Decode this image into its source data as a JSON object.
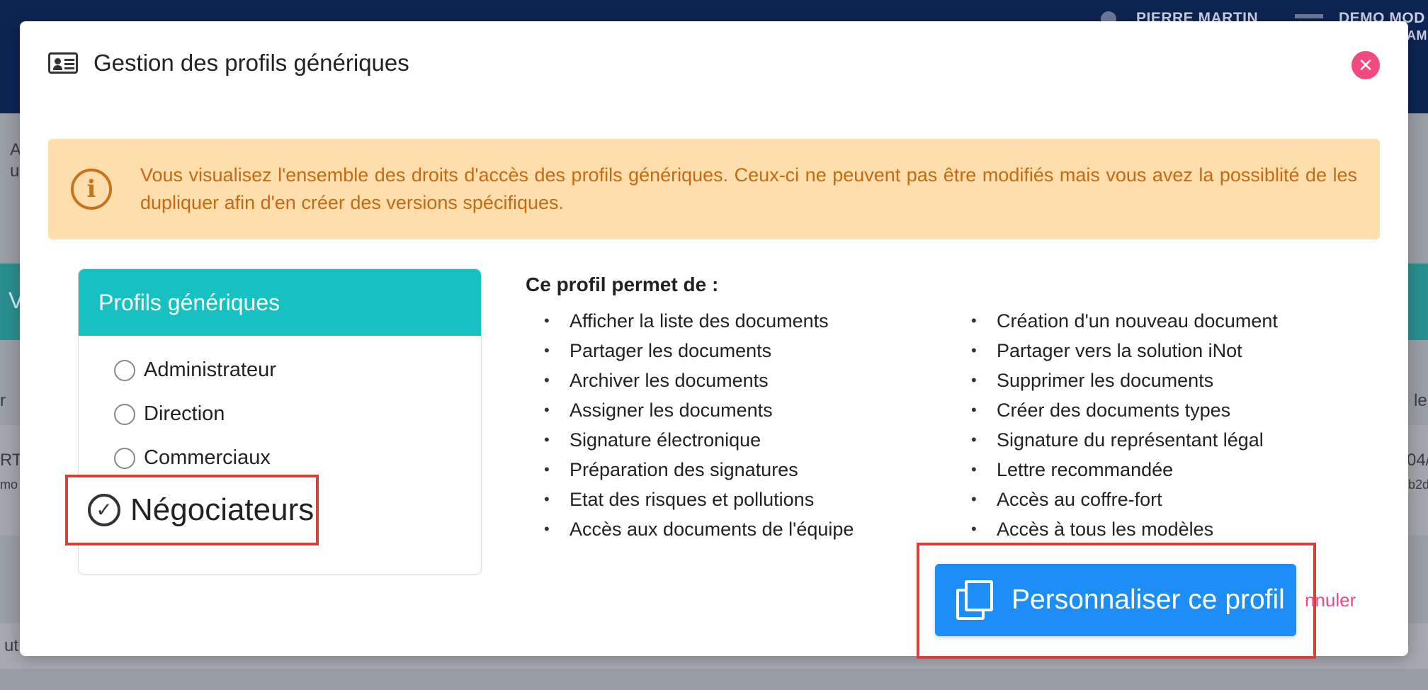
{
  "background": {
    "user_name": "PIERRE MARTIN",
    "demo_label": "DEMO MOD",
    "demo_sub": "AM",
    "fragments": {
      "a": "A",
      "u": "u",
      "v": "V",
      "r": "r",
      "rt": "RT",
      "mo": "mo",
      "ut": "ut",
      "le": "e le",
      "num": "04/",
      "code": "b2d"
    }
  },
  "modal": {
    "title": "Gestion des profils génériques",
    "close_icon": "close-icon",
    "alert_text": "Vous visualisez l'ensemble des droits d'accès des profils génériques. Ceux-ci ne peuvent pas être modifiés mais vous avez la possiblité de les dupliquer afin d'en créer des versions spécifiques.",
    "profiles": {
      "title": "Profils génériques",
      "items": [
        {
          "label": "Administrateur"
        },
        {
          "label": "Direction"
        },
        {
          "label": "Commerciaux"
        }
      ],
      "selected": {
        "label": "Négociateurs"
      }
    },
    "permissions": {
      "title": "Ce profil permet de :",
      "left": [
        "Afficher la liste des documents",
        "Partager les documents",
        "Archiver les documents",
        "Assigner les documents",
        "Signature électronique",
        "Préparation des signatures",
        "Etat des risques et pollutions",
        "Accès aux documents de l'équipe"
      ],
      "right": [
        "Création d'un nouveau document",
        "Partager vers la solution iNot",
        "Supprimer les documents",
        "Créer des documents types",
        "Signature du représentant légal",
        "Lettre recommandée",
        "Accès au coffre-fort",
        "Accès à tous les modèles"
      ]
    },
    "actions": {
      "customize_label": "Personnaliser ce profil",
      "cancel_label": "nnuler"
    }
  },
  "colors": {
    "header_bg": "#0e2452",
    "teal": "#17c1c1",
    "alert_bg": "#fddeac",
    "alert_text": "#c36a12",
    "primary": "#1c8ef5",
    "danger": "#f24a7f",
    "highlight": "#d2413a"
  }
}
